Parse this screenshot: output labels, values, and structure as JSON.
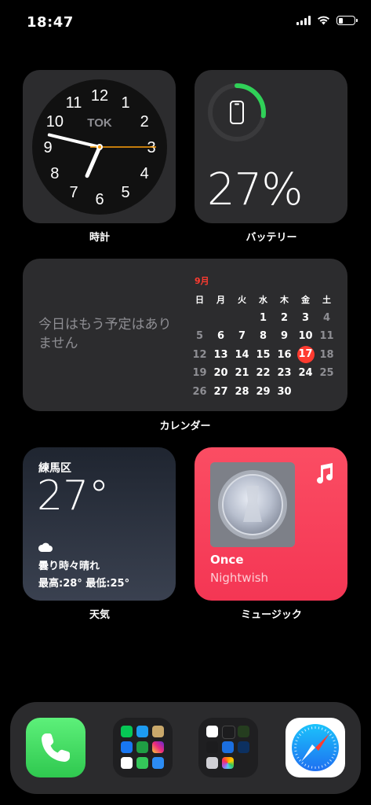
{
  "status_bar": {
    "time": "18:47",
    "battery_level": 0.27
  },
  "clock_widget": {
    "city": "TOK",
    "numbers": [
      "12",
      "1",
      "2",
      "3",
      "4",
      "5",
      "6",
      "7",
      "8",
      "9",
      "10",
      "11"
    ],
    "time_shown": "18:47:15",
    "label": "時計"
  },
  "battery_widget": {
    "percent_text": "27%",
    "level": 0.27,
    "label": "バッテリー",
    "device_icon": "iphone-icon"
  },
  "calendar_widget": {
    "empty_message": "今日はもう予定はありません",
    "month": "9月",
    "weekdays": [
      "日",
      "月",
      "火",
      "水",
      "木",
      "金",
      "土"
    ],
    "weeks": [
      [
        "",
        "",
        "",
        "1",
        "2",
        "3",
        "4"
      ],
      [
        "5",
        "6",
        "7",
        "8",
        "9",
        "10",
        "11"
      ],
      [
        "12",
        "13",
        "14",
        "15",
        "16",
        "17",
        "18"
      ],
      [
        "19",
        "20",
        "21",
        "22",
        "23",
        "24",
        "25"
      ],
      [
        "26",
        "27",
        "28",
        "29",
        "30",
        "",
        ""
      ]
    ],
    "today": "17",
    "label": "カレンダー"
  },
  "weather_widget": {
    "location": "練馬区",
    "temperature": "27°",
    "condition": "曇り時々晴れ",
    "hi_lo": "最高:28° 最低:25°",
    "condition_icon": "cloud-icon",
    "label": "天気"
  },
  "music_widget": {
    "song": "Once",
    "artist": "Nightwish",
    "app_icon": "music-note-icon",
    "label": "ミュージック"
  },
  "dock": {
    "apps": [
      {
        "name": "phone",
        "icon": "phone-icon"
      },
      {
        "name": "folder-social",
        "icon": "folder-icon"
      },
      {
        "name": "folder-photo",
        "icon": "folder-icon"
      },
      {
        "name": "safari",
        "icon": "compass-icon"
      }
    ]
  },
  "colors": {
    "accent_green": "#30d158",
    "today_red": "#ff3b30",
    "music_red": "#fb4d63",
    "clock_orange": "#ff9f0a"
  }
}
